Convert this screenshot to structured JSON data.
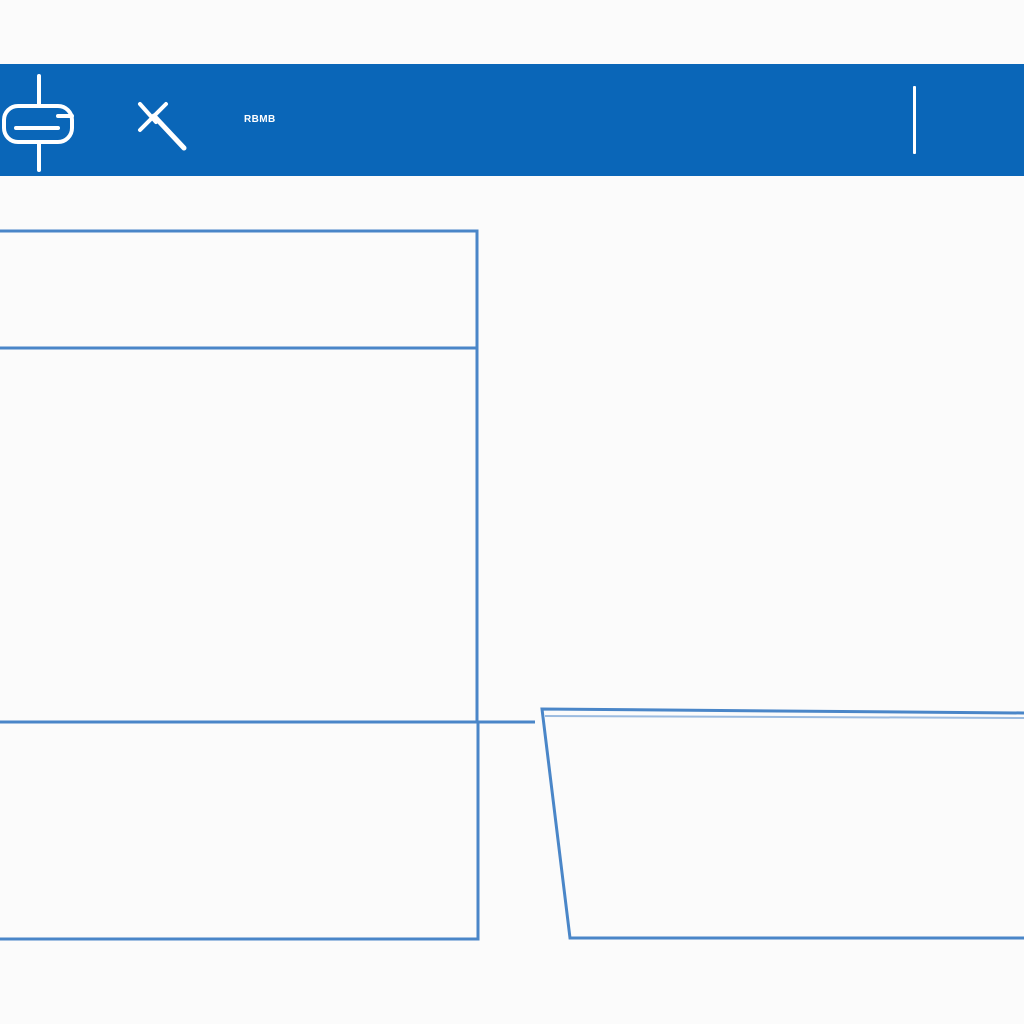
{
  "toolbar": {
    "label": "RBMB",
    "color": "#0a66b8",
    "icons": [
      "plug-connector-icon",
      "wrench-tools-icon"
    ]
  },
  "wireframe": {
    "stroke_color": "#4a86c8",
    "panels": [
      "left-top-panel",
      "left-main-panel",
      "left-bottom-panel",
      "right-bottom-panel"
    ]
  }
}
